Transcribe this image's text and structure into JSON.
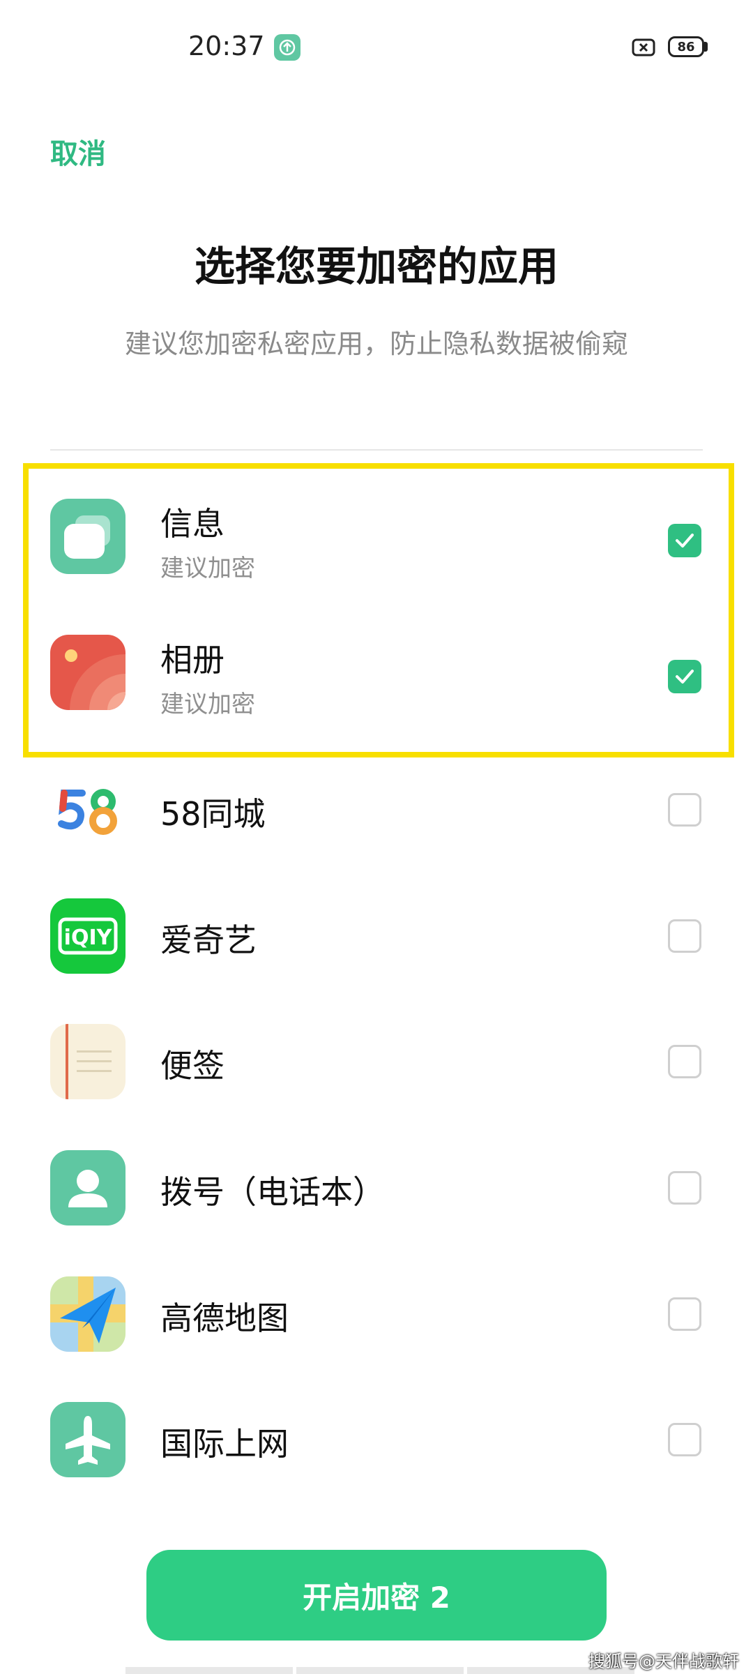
{
  "status_bar": {
    "time": "20:37",
    "battery": "86"
  },
  "header": {
    "cancel_label": "取消",
    "title": "选择您要加密的应用",
    "subtitle": "建议您加密私密应用，防止隐私数据被偷窥"
  },
  "apps": [
    {
      "name": "信息",
      "hint": "建议加密",
      "checked": true,
      "icon": "messages-icon"
    },
    {
      "name": "相册",
      "hint": "建议加密",
      "checked": true,
      "icon": "gallery-icon"
    },
    {
      "name": "58同城",
      "checked": false,
      "icon": "58-icon"
    },
    {
      "name": "爱奇艺",
      "checked": false,
      "icon": "iqiyi-icon"
    },
    {
      "name": "便签",
      "checked": false,
      "icon": "notes-icon"
    },
    {
      "name": "拨号（电话本）",
      "checked": false,
      "icon": "contacts-icon"
    },
    {
      "name": "高德地图",
      "checked": false,
      "icon": "amap-icon"
    },
    {
      "name": "国际上网",
      "checked": false,
      "icon": "airplane-icon"
    }
  ],
  "footer": {
    "enable_button_label": "开启加密 2"
  },
  "watermark": "搜狐号@天伴战歌轩",
  "colors": {
    "accent": "#2fbf82",
    "highlight": "#f8df00"
  }
}
